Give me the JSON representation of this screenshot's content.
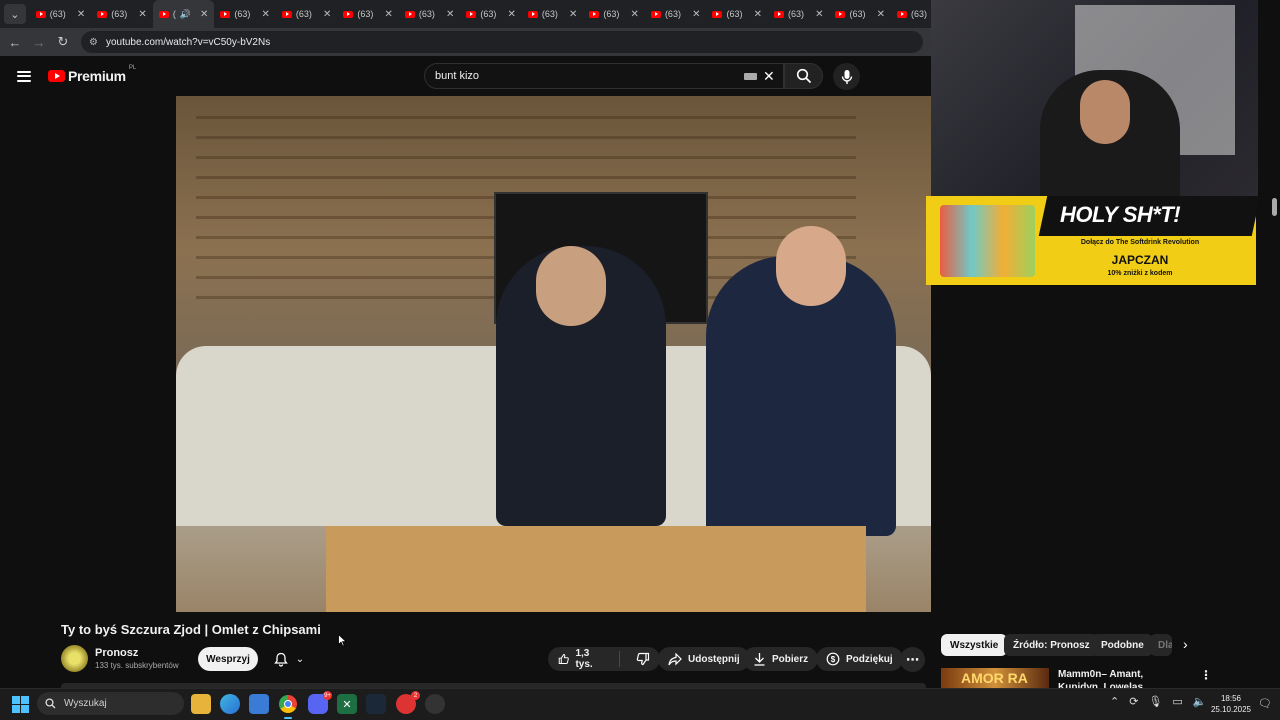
{
  "browser": {
    "tab_count_label": "(63)",
    "tabs": [
      "(63)",
      "(63)",
      "(",
      "(63)",
      "(63)",
      "(63)",
      "(63)",
      "(63)",
      "(63)",
      "(63)",
      "(63)",
      "(63)",
      "(63)",
      "(63)",
      "(63)"
    ],
    "url": "youtube.com/watch?v=vC50y-bV2Ns"
  },
  "youtube": {
    "logo_text": "Premium",
    "logo_region": "PL",
    "search_value": "bunt kizo"
  },
  "video": {
    "title": "Ty to byś Szczura Zjod | Omlet z Chipsami",
    "channel": "Pronosz",
    "subscribers": "133 tys. subskrybentów",
    "support_label": "Wesprzyj",
    "likes": "1,3 tys.",
    "share_label": "Udostępnij",
    "download_label": "Pobierz",
    "thanks_label": "Podziękuj"
  },
  "ad": {
    "title": "HOLY SH*T!",
    "subtitle": "Dołącz do The Softdrink Revolution",
    "code": "JAPCZAN",
    "discount": "10% zniżki z kodem"
  },
  "chips": [
    "Wszystkie",
    "Źródło: Pronosz",
    "Podobne",
    "Dla"
  ],
  "recommendation": {
    "thumb_text": "AMOR RA",
    "title": "Mamm0n– Amant, Kupidyn, Lowelas"
  },
  "taskbar": {
    "search_placeholder": "Wyszukaj",
    "discord_badge": "9+",
    "app_badge": "2",
    "time": "18:56",
    "date": "25.10.2025"
  },
  "colors": {
    "accent": "#ff0000",
    "background": "#0f0f0f",
    "ad_yellow": "#f1cd16"
  }
}
